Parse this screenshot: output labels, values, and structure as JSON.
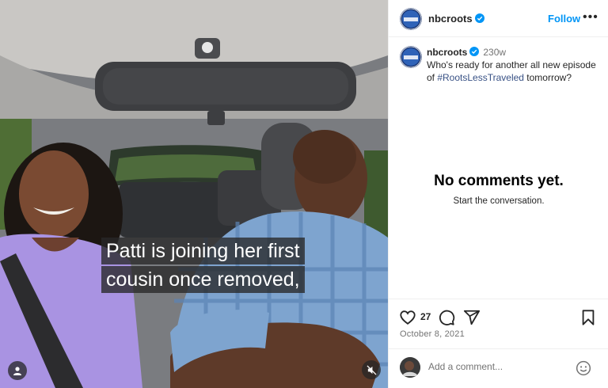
{
  "media": {
    "caption_lines": [
      "Patti is joining her first",
      "cousin once removed,"
    ],
    "user_tag_icon": "user-tag-icon",
    "mute_icon": "speaker-muted-icon"
  },
  "header": {
    "username": "nbcroots",
    "follow_label": "Follow",
    "more_label": "•••"
  },
  "post": {
    "username": "nbcroots",
    "age": "230w",
    "text_before": "Who's ready for another all new episode of ",
    "hashtag": "#RootsLessTraveled",
    "text_after": " tomorrow?"
  },
  "comments": {
    "empty_title": "No comments yet.",
    "empty_subtitle": "Start the conversation."
  },
  "actions": {
    "like_count": "27",
    "date": "October 8, 2021"
  },
  "comment_bar": {
    "placeholder": "Add a comment..."
  },
  "colors": {
    "accent": "#0095f6",
    "verified": "#0095f6",
    "muted_text": "#737373"
  }
}
